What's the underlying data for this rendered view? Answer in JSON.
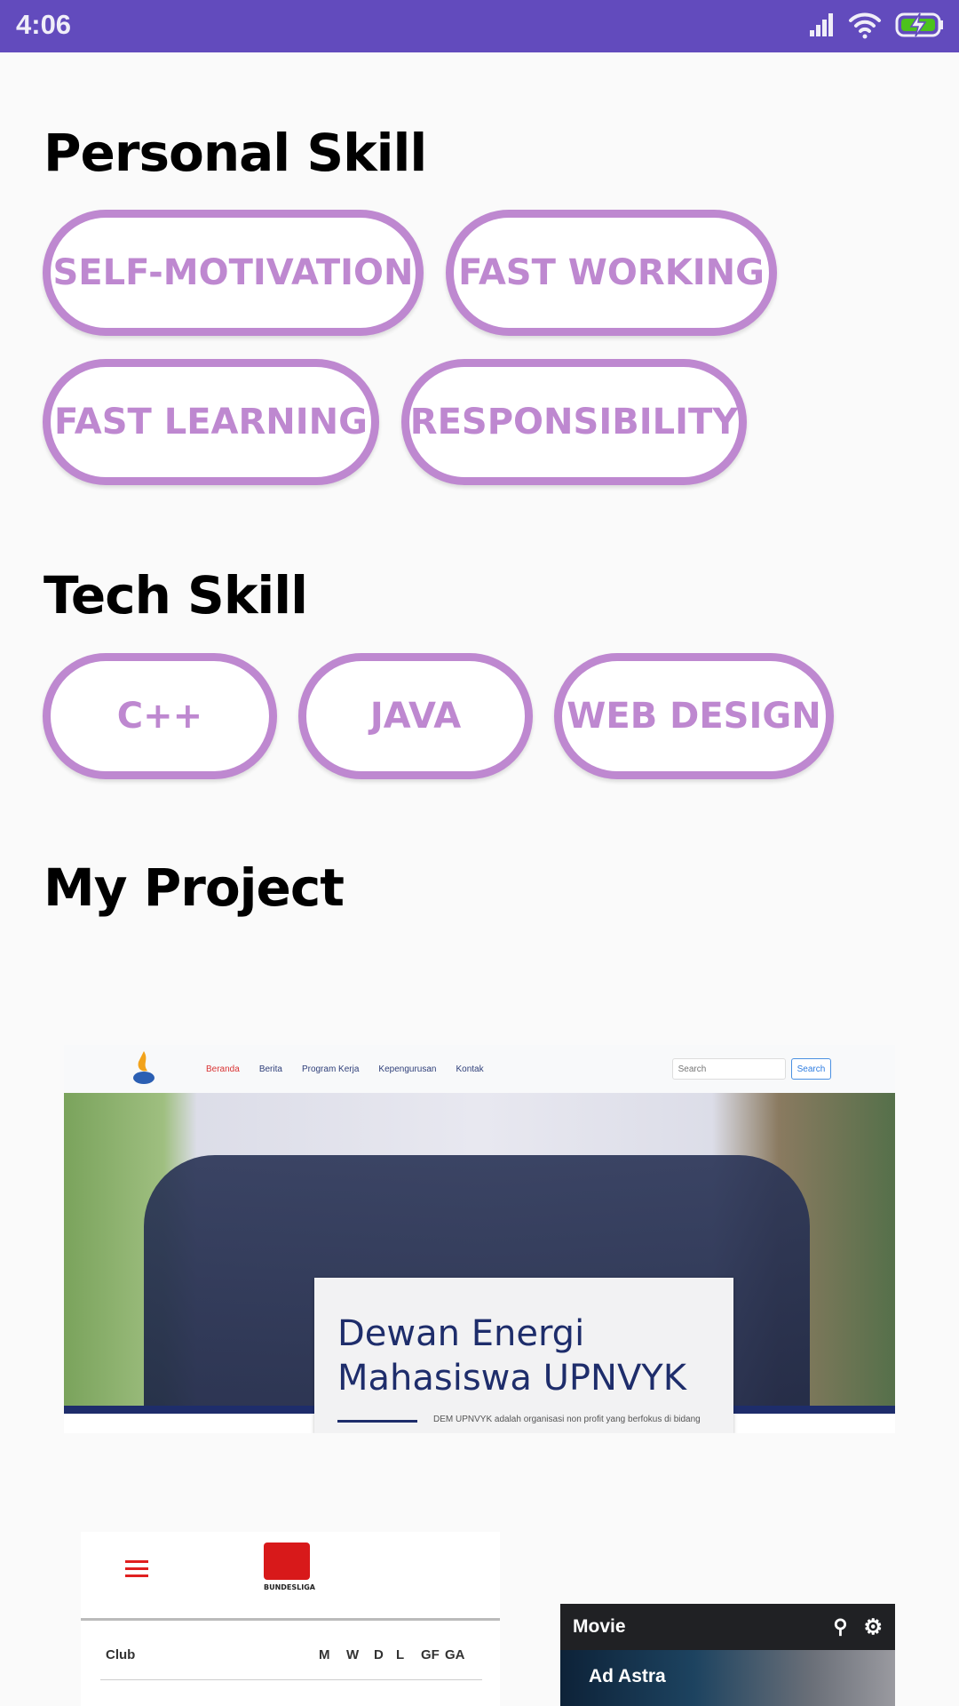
{
  "status_bar": {
    "time": "4:06",
    "icons": [
      "signal-icon",
      "wifi-icon",
      "battery-charging-icon"
    ],
    "color": "#624bbd"
  },
  "sections": {
    "personal": "Personal Skill",
    "tech": "Tech Skill",
    "project": "My Project"
  },
  "personal_skills": [
    "SELF-MOTIVATION",
    "FAST WORKING",
    "FAST LEARNING",
    "RESPONSIBILITY"
  ],
  "tech_skills": [
    "C++",
    "JAVA",
    "WEB DESIGN"
  ],
  "chip_color": "#be88d0",
  "projects": {
    "dem": {
      "nav": [
        "Beranda",
        "Berita",
        "Program Kerja",
        "Kepengurusan",
        "Kontak"
      ],
      "search_placeholder": "Search",
      "search_button": "Search",
      "title_line1": "Dewan Energi",
      "title_line2": "Mahasiswa UPNVYK",
      "description": "DEM UPNVYK adalah organisasi non profit yang berfokus di bidang"
    },
    "bundesliga": {
      "logo_text": "BUNDESLIGA",
      "columns": [
        "Club",
        "M",
        "W",
        "D",
        "L",
        "GF",
        "GA"
      ]
    },
    "movie": {
      "title": "Movie",
      "featured": "Ad Astra"
    }
  }
}
